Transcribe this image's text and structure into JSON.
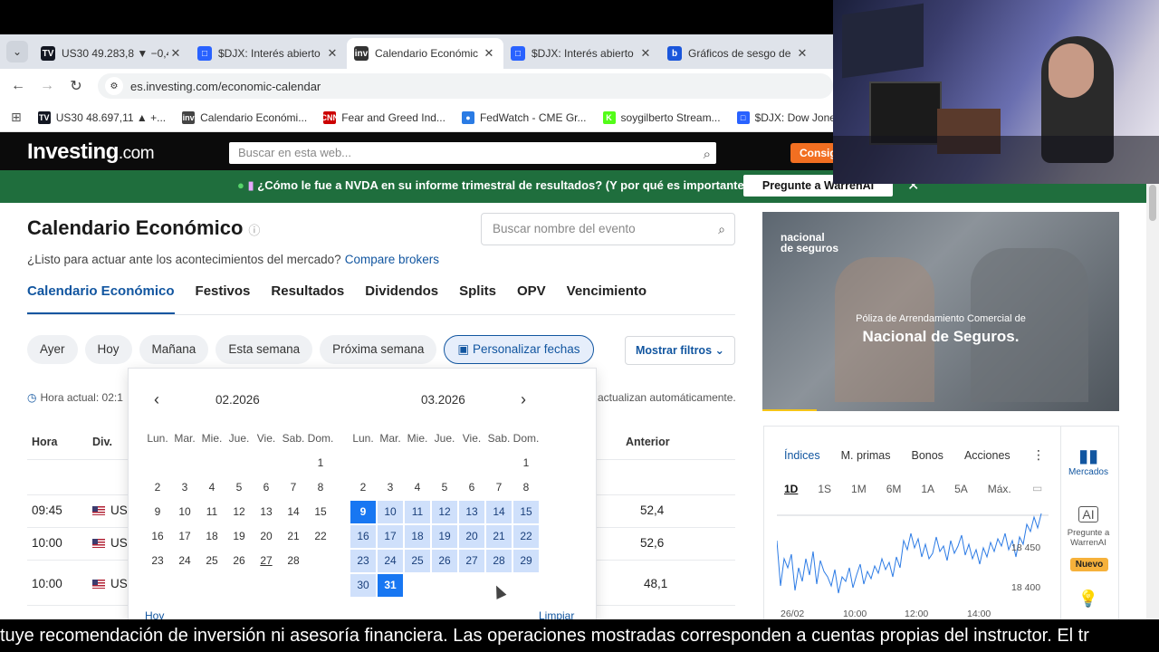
{
  "browser": {
    "tabs": [
      {
        "title": "US30 49.283,8 ▼ −0,4",
        "fav": "TV",
        "color": "#131722"
      },
      {
        "title": "$DJX: Interés abierto",
        "fav": "□",
        "color": "#2962ff"
      },
      {
        "title": "Calendario Económic",
        "fav": "inv",
        "color": "#333",
        "active": true
      },
      {
        "title": "$DJX: Interés abierto",
        "fav": "□",
        "color": "#2962ff"
      },
      {
        "title": "Gráficos de sesgo de",
        "fav": "b",
        "color": "#1a56db"
      }
    ],
    "url": "es.investing.com/economic-calendar",
    "bookmarks": [
      {
        "title": "US30 48.697,11 ▲ +...",
        "fav": "TV",
        "color": "#131722"
      },
      {
        "title": "Calendario Económi...",
        "fav": "inv",
        "color": "#444"
      },
      {
        "title": "Fear and Greed Ind...",
        "fav": "CNN",
        "color": "#cc0000"
      },
      {
        "title": "FedWatch - CME Gr...",
        "fav": "●",
        "color": "#2a7be4"
      },
      {
        "title": "soygilberto Stream...",
        "fav": "K",
        "color": "#53fc18"
      },
      {
        "title": "$DJX: Dow Jones In...",
        "fav": "□",
        "color": "#2962ff"
      }
    ]
  },
  "header": {
    "logo": "Investing",
    "logo_suffix": ".com",
    "search_placeholder": "Buscar en esta web...",
    "cta": "Consig"
  },
  "promo": {
    "text": "¿Cómo le fue a NVDA en su informe trimestral de resultados? (Y por qué es importante)",
    "button": "Pregunte a WarrenAI"
  },
  "page": {
    "title": "Calendario Económico",
    "subtitle": "¿Listo para actuar ante los acontecimientos del mercado?",
    "subtitle_link": "Compare brokers",
    "event_search_placeholder": "Buscar nombre del evento",
    "tabs": [
      "Calendario Económico",
      "Festivos",
      "Resultados",
      "Dividendos",
      "Splits",
      "OPV",
      "Vencimiento"
    ],
    "chips": [
      "Ayer",
      "Hoy",
      "Mañana",
      "Esta semana",
      "Próxima semana"
    ],
    "custom_dates": "Personalizar fechas",
    "filters": "Mostrar filtros",
    "current_time_label": "Hora actual: 02:1",
    "auto_update": "actualizan automáticamente.",
    "columns": {
      "hora": "Hora",
      "div": "Div.",
      "anterior": "Anterior"
    },
    "rows": [
      {
        "time": "09:45",
        "country": "US",
        "previous": "52,4"
      },
      {
        "time": "10:00",
        "country": "US",
        "previous": "52,6"
      },
      {
        "time": "10:00",
        "country": "US",
        "previous": "48,1"
      }
    ]
  },
  "calendar": {
    "left_month": "02.2026",
    "right_month": "03.2026",
    "dow": [
      "Lun.",
      "Mar.",
      "Mie.",
      "Jue.",
      "Vie.",
      "Sab.",
      "Dom."
    ],
    "footer_left": "Hoy",
    "footer_right": "Limpiar"
  },
  "ad": {
    "logo_line1": "nacional",
    "logo_line2": "de seguros",
    "sub": "Póliza de Arrendamiento Comercial de",
    "main": "Nacional de Seguros."
  },
  "markets": {
    "tabs": [
      "Índices",
      "M. primas",
      "Bonos",
      "Acciones"
    ],
    "ranges": [
      "1D",
      "1S",
      "1M",
      "6M",
      "1A",
      "5A",
      "Máx."
    ],
    "side_markets": "Mercados",
    "side_ai": "Pregunte a WarrenAI",
    "badge": "Nuevo",
    "y_labels": [
      "18 450",
      "18 400"
    ],
    "x_labels": [
      "26/02",
      "10:00",
      "12:00",
      "14:00"
    ]
  },
  "subtitles": "tuye recomendación de inversión ni asesoría financiera. Las operaciones mostradas corresponden a cuentas propias del instructor. El tr"
}
